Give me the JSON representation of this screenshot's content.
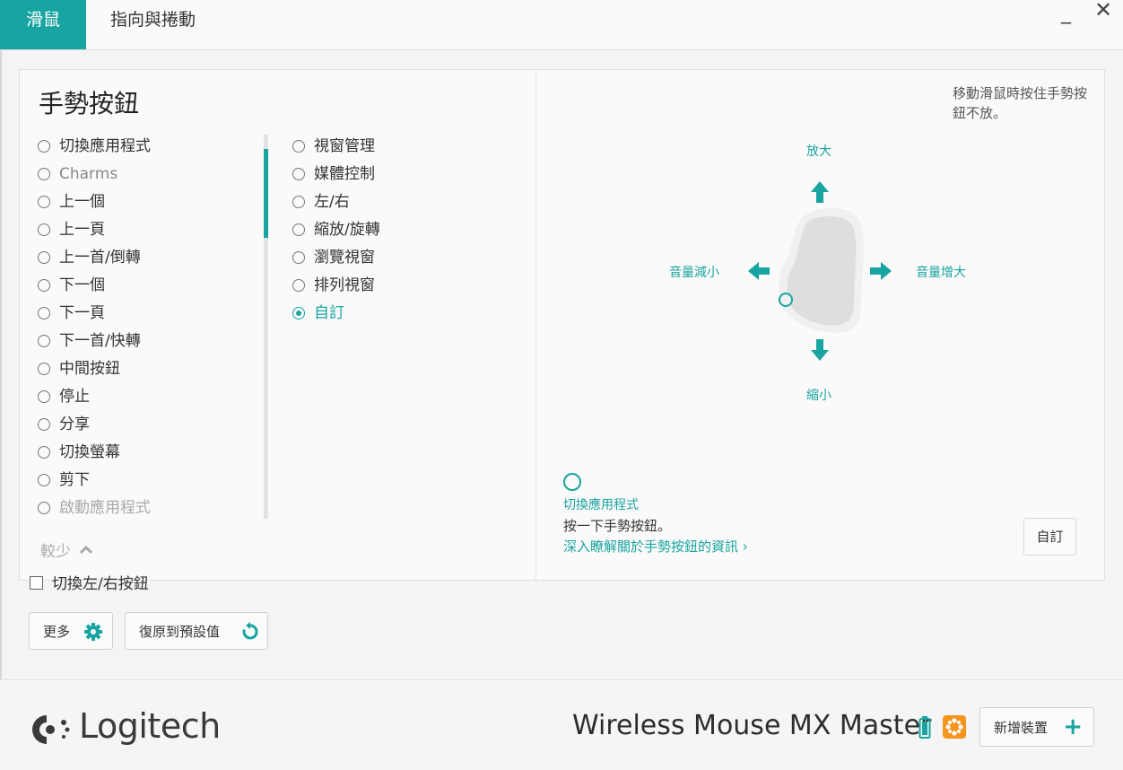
{
  "tabs": [
    {
      "label": "滑鼠",
      "active": true
    },
    {
      "label": "指向與捲動",
      "active": false
    }
  ],
  "window_controls": {
    "minimize": "_",
    "close": "✕"
  },
  "panel": {
    "title": "手勢按鈕",
    "left_options": [
      {
        "label": "切換應用程式"
      },
      {
        "label": "Charms"
      },
      {
        "label": "上一個"
      },
      {
        "label": "上一頁"
      },
      {
        "label": "上一首/倒轉"
      },
      {
        "label": "下一個"
      },
      {
        "label": "下一頁"
      },
      {
        "label": "下一首/快轉"
      },
      {
        "label": "中間按鈕"
      },
      {
        "label": "停止"
      },
      {
        "label": "分享"
      },
      {
        "label": "切換螢幕"
      },
      {
        "label": "剪下"
      },
      {
        "label": "啟動應用程式"
      }
    ],
    "right_options": [
      {
        "label": "視窗管理"
      },
      {
        "label": "媒體控制"
      },
      {
        "label": "左/右"
      },
      {
        "label": "縮放/旋轉"
      },
      {
        "label": "瀏覽視窗"
      },
      {
        "label": "排列視窗"
      },
      {
        "label": "自訂"
      }
    ],
    "selected_option": "自訂",
    "fewer_label": "較少"
  },
  "gesture": {
    "hint": "移動滑鼠時按住手勢按鈕不放。",
    "up": "放大",
    "down": "縮小",
    "left": "音量減小",
    "right": "音量增大",
    "click_action": "切換應用程式",
    "click_desc": "按一下手勢按鈕。",
    "learn_more": "深入瞭解關於手勢按鈕的資訊 ›",
    "custom_button": "自訂"
  },
  "bottom": {
    "swap_buttons": "切換左/右按鈕",
    "more_button": "更多",
    "reset_button": "復原到預設值"
  },
  "footer": {
    "brand": "Logitech",
    "device": "Wireless Mouse MX Master",
    "add_device": "新增裝置",
    "add_symbol": "+"
  },
  "colors": {
    "accent": "#18a4a0",
    "battery": "#18a4a0",
    "unifying": "#f7941d"
  }
}
